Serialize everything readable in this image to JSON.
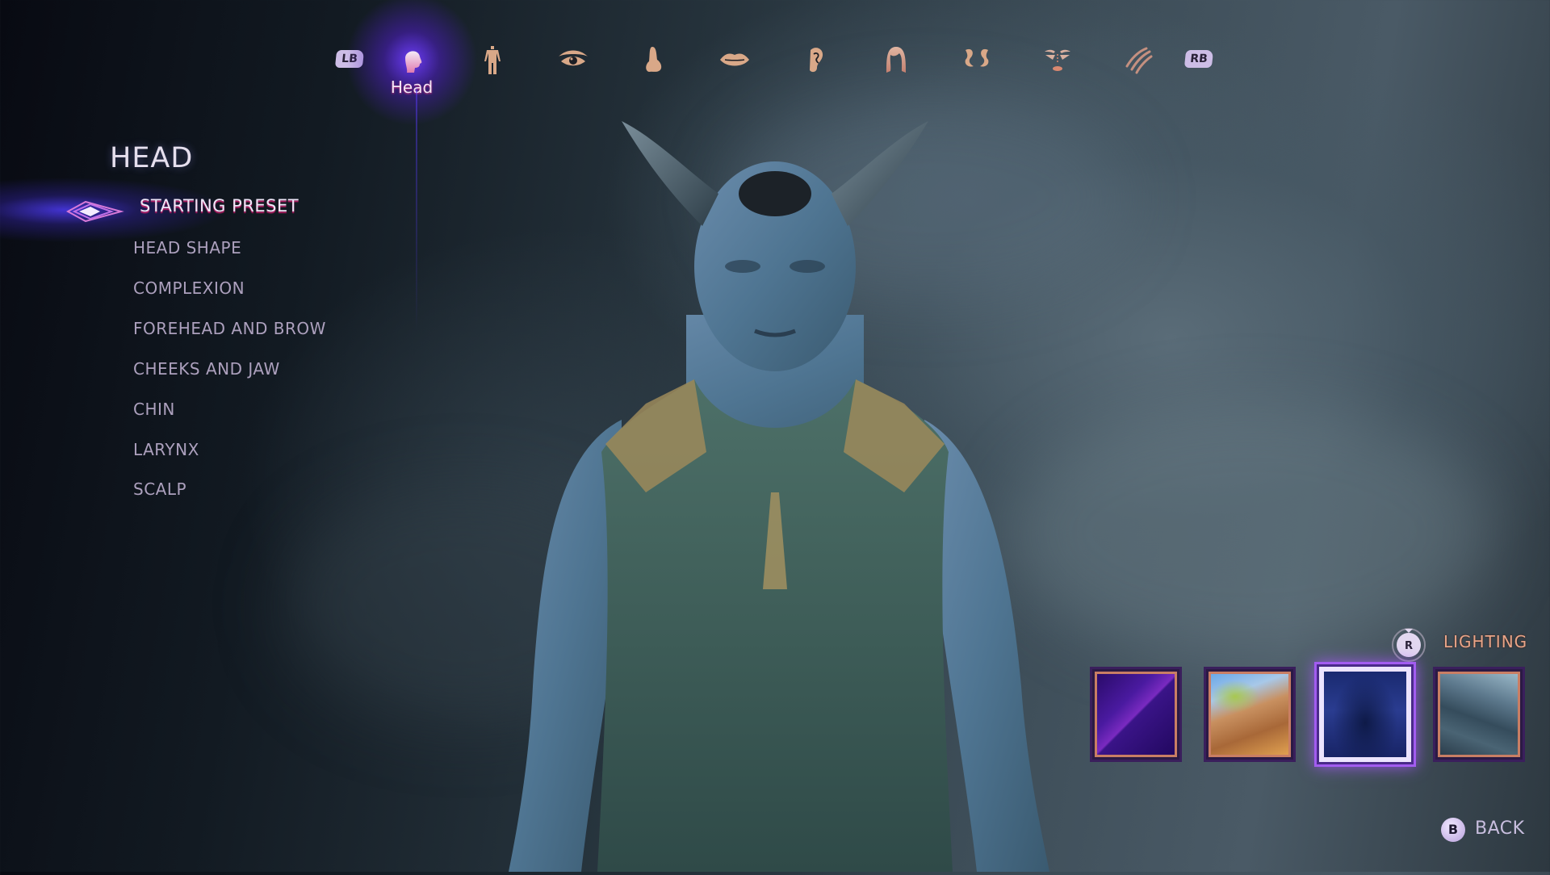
{
  "screen": "Character Creator - Appearance",
  "topbar": {
    "left_bumper": "LB",
    "right_bumper": "RB",
    "active_category_label": "Head",
    "categories": [
      {
        "id": "head",
        "icon": "head-icon",
        "active": true
      },
      {
        "id": "body",
        "icon": "body-icon",
        "active": false
      },
      {
        "id": "eyes",
        "icon": "eye-icon",
        "active": false
      },
      {
        "id": "nose",
        "icon": "nose-icon",
        "active": false
      },
      {
        "id": "mouth",
        "icon": "lips-icon",
        "active": false
      },
      {
        "id": "ears",
        "icon": "ear-icon",
        "active": false
      },
      {
        "id": "hair",
        "icon": "hair-icon",
        "active": false
      },
      {
        "id": "horns",
        "icon": "horns-icon",
        "active": false
      },
      {
        "id": "makeup",
        "icon": "face-paint-icon",
        "active": false
      },
      {
        "id": "scars",
        "icon": "scar-claw-icon",
        "active": false
      }
    ]
  },
  "menu": {
    "title": "HEAD",
    "selected_index": 0,
    "items": [
      {
        "label": "STARTING PRESET"
      },
      {
        "label": "HEAD SHAPE"
      },
      {
        "label": "COMPLEXION"
      },
      {
        "label": "FOREHEAD AND BROW"
      },
      {
        "label": "CHEEKS AND JAW"
      },
      {
        "label": "CHIN"
      },
      {
        "label": "LARYNX"
      },
      {
        "label": "SCALP"
      }
    ]
  },
  "lighting": {
    "button": "R",
    "label": "LIGHTING",
    "selected_index": 2,
    "presets": [
      {
        "name": "purple-studio"
      },
      {
        "name": "desert-palms"
      },
      {
        "name": "blue-night-ruins"
      },
      {
        "name": "misty-hall"
      }
    ]
  },
  "footer": {
    "back_button": "B",
    "back_label": "BACK"
  },
  "colors": {
    "accent_purple": "#6e3cff",
    "menu_text": "#aca0bd",
    "lighting_label": "#e8a488",
    "thumb_border": "#c97e64"
  }
}
